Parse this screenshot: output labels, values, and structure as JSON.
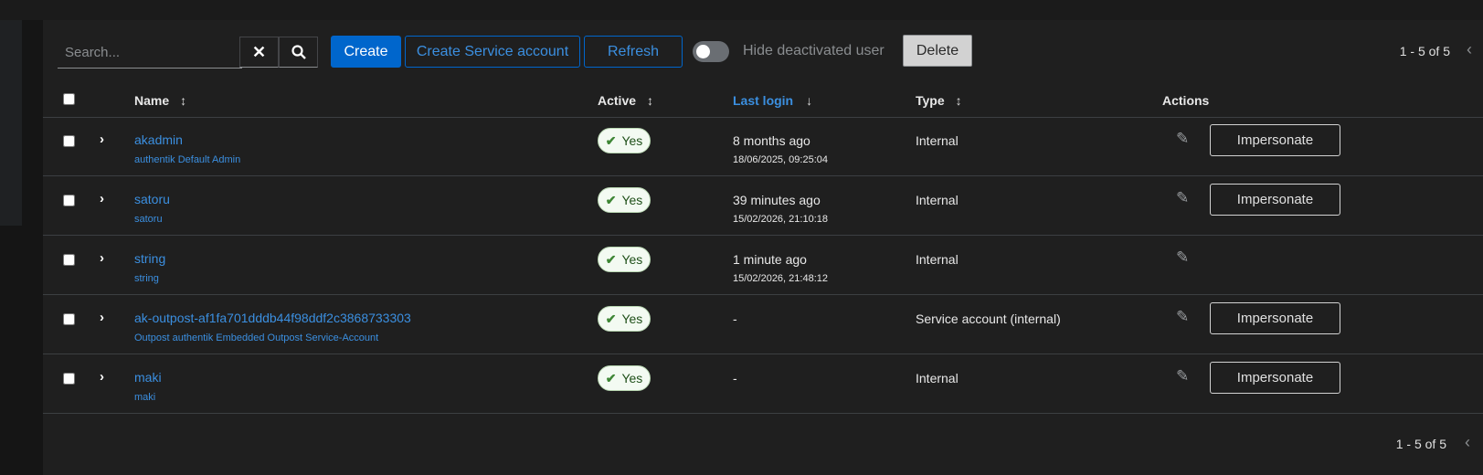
{
  "toolbar": {
    "search_placeholder": "Search...",
    "create_label": "Create",
    "create_service_account_label": "Create Service account",
    "refresh_label": "Refresh",
    "hide_deactivated_label": "Hide deactivated user",
    "hide_deactivated_on": false,
    "delete_label": "Delete"
  },
  "pagination": {
    "top": "1 - 5 of 5",
    "bottom": "1 - 5 of 5"
  },
  "columns": {
    "name": "Name",
    "active": "Active",
    "last_login": "Last login",
    "type": "Type",
    "actions": "Actions"
  },
  "rows": [
    {
      "name": "akadmin",
      "sub": "authentik Default Admin",
      "active": "Yes",
      "last_login": "8 months ago",
      "last_login_exact": "18/06/2025, 09:25:04",
      "type": "Internal",
      "impersonate": "Impersonate"
    },
    {
      "name": "satoru",
      "sub": "satoru",
      "active": "Yes",
      "last_login": "39 minutes ago",
      "last_login_exact": "15/02/2026, 21:10:18",
      "type": "Internal",
      "impersonate": "Impersonate"
    },
    {
      "name": "string",
      "sub": "string",
      "active": "Yes",
      "last_login": "1 minute ago",
      "last_login_exact": "15/02/2026, 21:48:12",
      "type": "Internal"
    },
    {
      "name": "ak-outpost-af1fa701dddb44f98ddf2c3868733303",
      "sub": "Outpost authentik Embedded Outpost Service-Account",
      "active": "Yes",
      "last_login": "-",
      "type": "Service account (internal)",
      "impersonate": "Impersonate"
    },
    {
      "name": "maki",
      "sub": "maki",
      "active": "Yes",
      "last_login": "-",
      "type": "Internal",
      "impersonate": "Impersonate"
    }
  ],
  "icons": {
    "clear": "close-icon",
    "search": "search-icon",
    "sort": "sort-icon",
    "expand": "chevron-right-icon",
    "active_check": "check-icon",
    "edit": "edit-icon",
    "prev_page": "chevron-left-icon"
  },
  "colors": {
    "primary": "#0066cc",
    "link": "#3b8fe0",
    "success": "#3e8635"
  }
}
